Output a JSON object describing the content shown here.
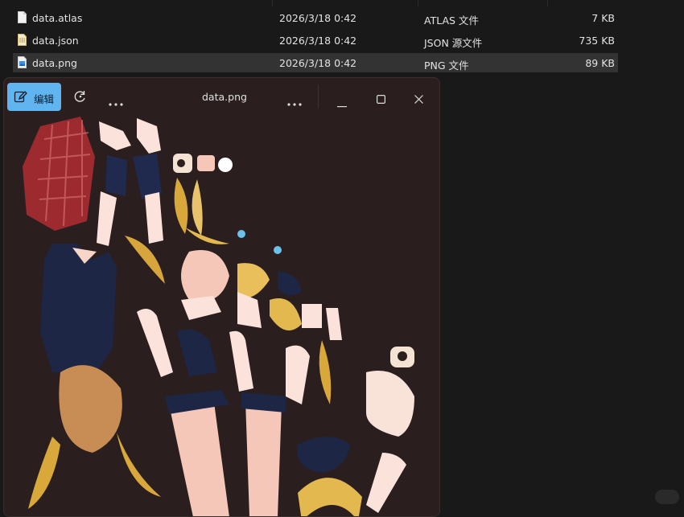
{
  "files": [
    {
      "name": "data.atlas",
      "date": "2026/3/18 0:42",
      "type": "ATLAS 文件",
      "size": "7 KB",
      "icon": "file-icon",
      "selected": false
    },
    {
      "name": "data.json",
      "date": "2026/3/18 0:42",
      "type": "JSON 源文件",
      "size": "735 KB",
      "icon": "json-file-icon",
      "selected": false
    },
    {
      "name": "data.png",
      "date": "2026/3/18 0:42",
      "type": "PNG 文件",
      "size": "89 KB",
      "icon": "image-file-icon",
      "selected": true
    }
  ],
  "viewer": {
    "edit_label": "编辑",
    "title": "data.png",
    "icons": {
      "edit": "pencil-icon",
      "rotate": "rotate-icon",
      "more_left": "more-icon",
      "more_right": "more-icon",
      "minimize": "minimize-icon",
      "maximize": "maximize-icon",
      "close": "close-icon"
    },
    "accent_color": "#60b4f0",
    "background_color": "#2a1e1e"
  }
}
